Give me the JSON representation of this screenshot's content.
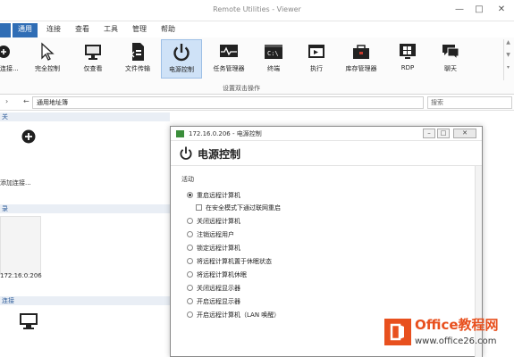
{
  "window": {
    "title": "Remote Utilities - Viewer"
  },
  "menu": {
    "tabs": [
      "通用",
      "连接",
      "查看",
      "工具",
      "管理",
      "帮助"
    ],
    "active": 0
  },
  "ribbon": {
    "buttons": [
      {
        "label": "完全控制",
        "icon": "cursor-icon"
      },
      {
        "label": "仅查看",
        "icon": "monitor-icon"
      },
      {
        "label": "文件传输",
        "icon": "file-transfer-icon"
      },
      {
        "label": "电源控制",
        "icon": "power-icon"
      },
      {
        "label": "任务管理器",
        "icon": "task-manager-icon"
      },
      {
        "label": "终端",
        "icon": "terminal-icon"
      },
      {
        "label": "执行",
        "icon": "execute-icon"
      },
      {
        "label": "库存管理器",
        "icon": "inventory-icon"
      },
      {
        "label": "RDP",
        "icon": "rdp-icon"
      },
      {
        "label": "聊天",
        "icon": "chat-icon"
      }
    ],
    "active_index": 3,
    "group_label": "设置双击操作",
    "left_cut_label": "连接..."
  },
  "address": {
    "value": "通用地址簿",
    "search_placeholder": "搜索"
  },
  "left_pane": {
    "section1": "关",
    "add_label": "添加连接...",
    "section2": "录",
    "tile_label": "172.16.0.206",
    "section3": "连接"
  },
  "dialog": {
    "title": "172.16.0.206 - 电源控制",
    "header": "电源控制",
    "group_label": "活动",
    "options": [
      {
        "label": "重启远程计算机",
        "type": "radio",
        "checked": true
      },
      {
        "label": "在安全模式下通过联网重启",
        "type": "checkbox",
        "checked": false
      },
      {
        "label": "关闭远程计算机",
        "type": "radio",
        "checked": false
      },
      {
        "label": "注销远程用户",
        "type": "radio",
        "checked": false
      },
      {
        "label": "锁定远程计算机",
        "type": "radio",
        "checked": false
      },
      {
        "label": "将远程计算机置于休眠状态",
        "type": "radio",
        "checked": false
      },
      {
        "label": "将远程计算机休眠",
        "type": "radio",
        "checked": false
      },
      {
        "label": "关闭远程显示器",
        "type": "radio",
        "checked": false
      },
      {
        "label": "开启远程显示器",
        "type": "radio",
        "checked": false
      },
      {
        "label": "开启远程计算机（LAN 唤醒）",
        "type": "radio",
        "checked": false
      }
    ]
  },
  "watermark": {
    "brand": "Office教程网",
    "url": "www.office26.com"
  },
  "colors": {
    "accent": "#2f6db5",
    "active_button": "#cfe2f7",
    "watermark": "#e8501e"
  }
}
